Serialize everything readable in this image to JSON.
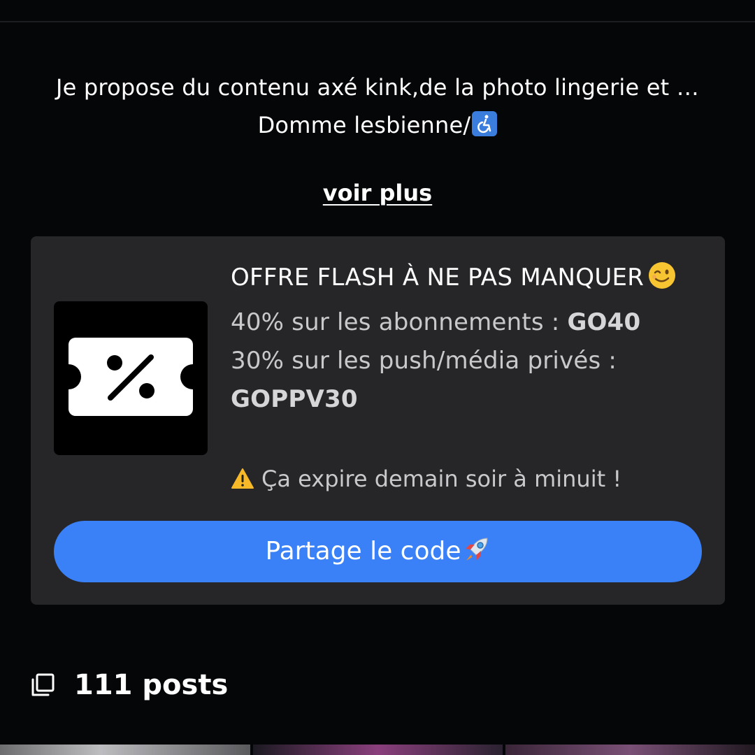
{
  "profile": {
    "bio_line_1": "Je propose du contenu axé kink,de la photo lingerie et …",
    "bio_line_2": "Domme lesbienne/",
    "bio_line_2_icon": "wheelchair-symbol-icon",
    "see_more_label": "voir plus"
  },
  "promo": {
    "icon": "discount-ticket-icon",
    "title": "OFFRE FLASH À NE PAS MANQUER",
    "title_emoji": "winking-face-icon",
    "offer_1_text": "40% sur les abonnements : ",
    "offer_1_code": "GO40",
    "offer_2_text": "30% sur les push/média privés :",
    "offer_2_code": "GOPPV30",
    "warning_icon": "warning-icon",
    "warning_text": "Ça expire demain soir à minuit !",
    "share_button_label": "Partage le code",
    "share_button_emoji": "rocket-icon"
  },
  "posts": {
    "icon": "gallery-icon",
    "count_label": "111 posts"
  },
  "colors": {
    "background": "#050608",
    "card": "#262629",
    "accent_button": "#3a80f6",
    "muted_text": "#c9c9cc"
  }
}
